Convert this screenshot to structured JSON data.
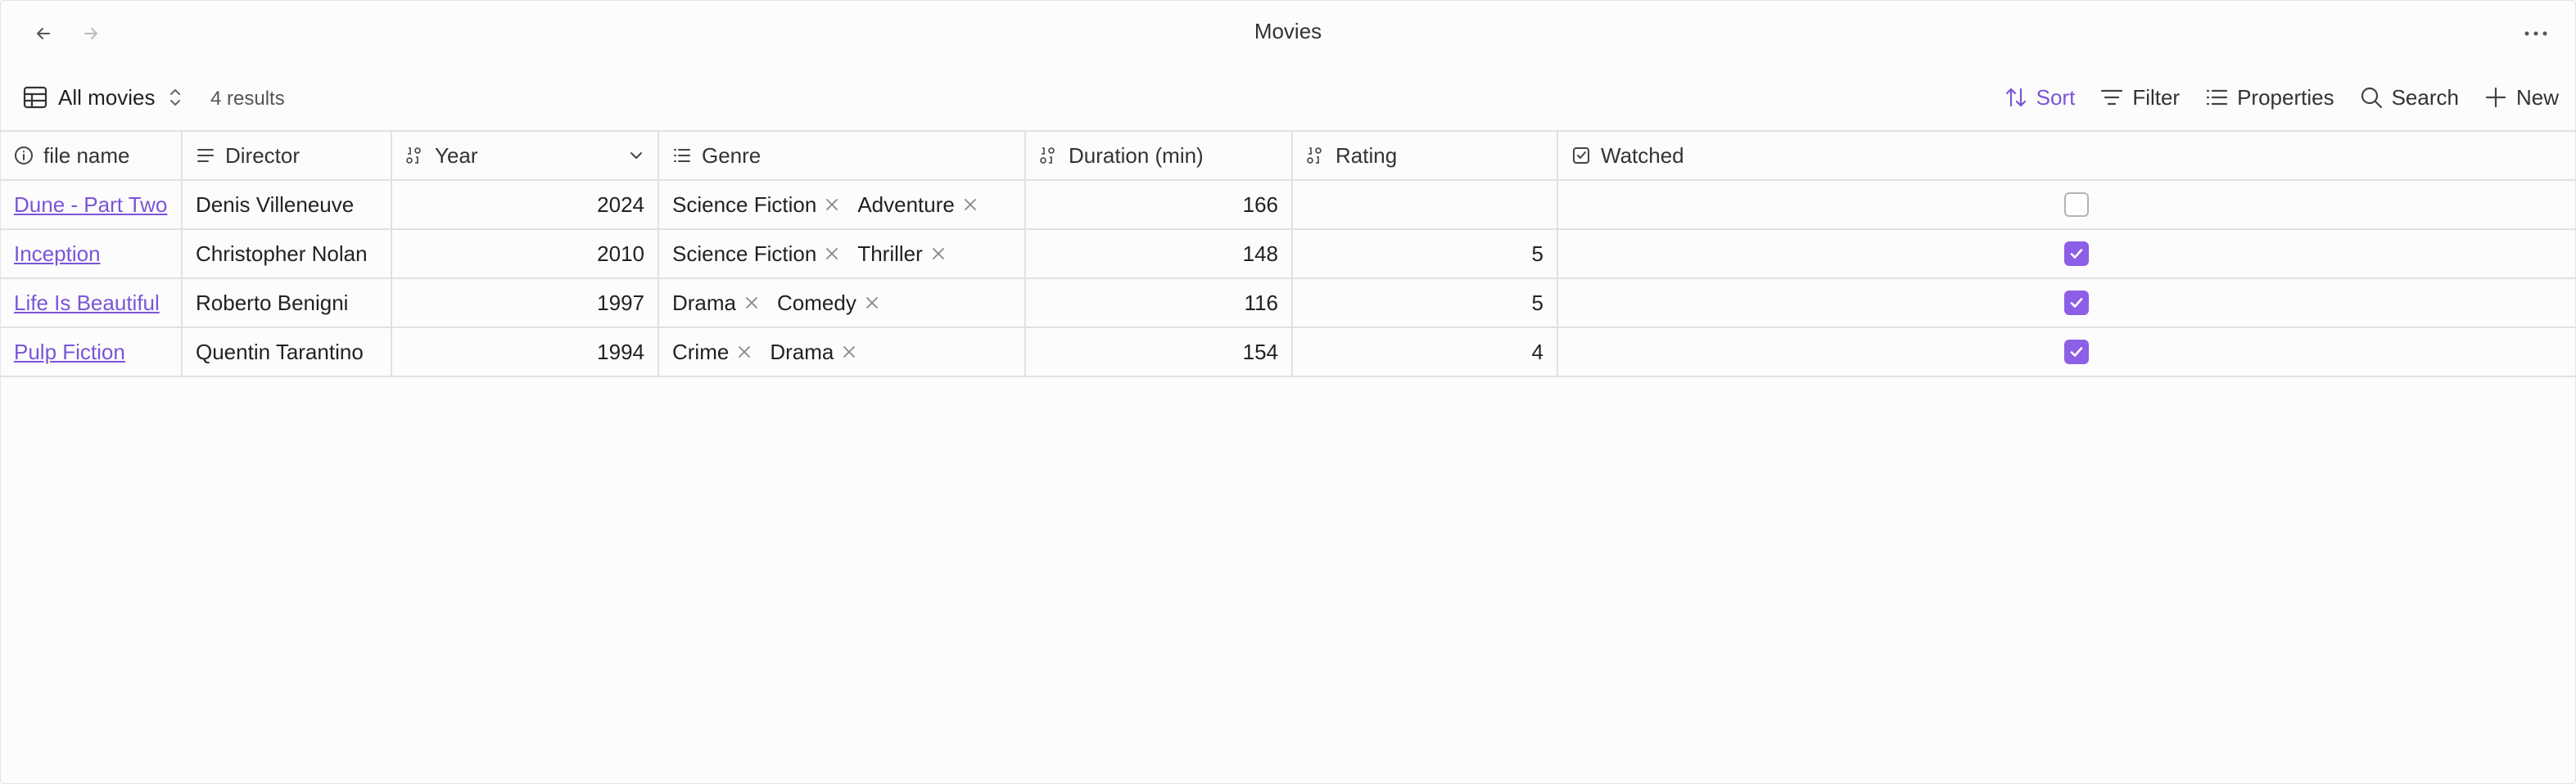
{
  "window": {
    "title": "Movies"
  },
  "toolbar": {
    "view_label": "All movies",
    "result_count": "4 results",
    "sort_label": "Sort",
    "filter_label": "Filter",
    "properties_label": "Properties",
    "search_label": "Search",
    "new_label": "New"
  },
  "colors": {
    "accent": "#7a55d8",
    "checkbox_checked": "#8c5fe6"
  },
  "table": {
    "columns": [
      {
        "label": "file name",
        "icon": "info-icon"
      },
      {
        "label": "Director",
        "icon": "text-lines-icon"
      },
      {
        "label": "Year",
        "icon": "number-icon",
        "sorted": "descending"
      },
      {
        "label": "Genre",
        "icon": "list-icon"
      },
      {
        "label": "Duration (min)",
        "icon": "number-icon"
      },
      {
        "label": "Rating",
        "icon": "number-icon"
      },
      {
        "label": "Watched",
        "icon": "checkbox-icon"
      }
    ],
    "rows": [
      {
        "file": "Dune - Part Two",
        "director": "Denis Villeneuve",
        "year": "2024",
        "genres": [
          "Science Fiction",
          "Adventure"
        ],
        "duration": "166",
        "rating": "",
        "watched": false
      },
      {
        "file": "Inception",
        "director": "Christopher Nolan",
        "year": "2010",
        "genres": [
          "Science Fiction",
          "Thriller"
        ],
        "duration": "148",
        "rating": "5",
        "watched": true
      },
      {
        "file": "Life Is Beautiful",
        "director": "Roberto Benigni",
        "year": "1997",
        "genres": [
          "Drama",
          "Comedy"
        ],
        "duration": "116",
        "rating": "5",
        "watched": true
      },
      {
        "file": "Pulp Fiction",
        "director": "Quentin Tarantino",
        "year": "1994",
        "genres": [
          "Crime",
          "Drama"
        ],
        "duration": "154",
        "rating": "4",
        "watched": true
      }
    ]
  }
}
